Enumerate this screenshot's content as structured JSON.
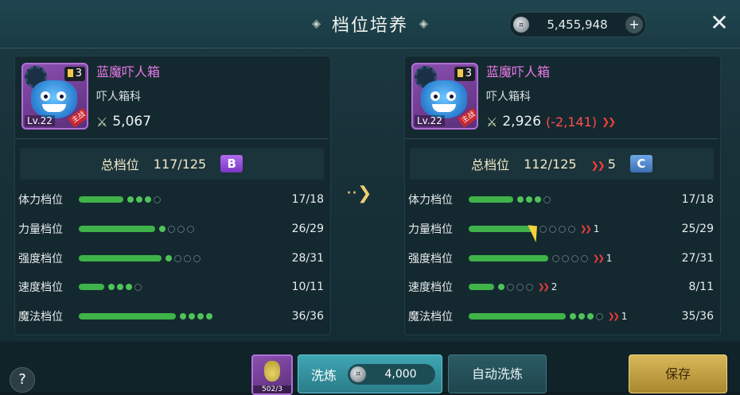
{
  "header": {
    "title": "档位培养",
    "currency": "5,455,948",
    "plus": "+",
    "close": "✕"
  },
  "left": {
    "name": "蓝魔吓人箱",
    "family": "吓人箱科",
    "power": "5,067",
    "level": "Lv.22",
    "grade_num": "3",
    "tag": "主战",
    "total_label": "总档位",
    "total_value": "117/125",
    "grade": "B",
    "rows": [
      {
        "label": "体力档位",
        "value": "17/18",
        "progress": 0.944
      },
      {
        "label": "力量档位",
        "value": "26/29",
        "progress": 0.897
      },
      {
        "label": "强度档位",
        "value": "28/31",
        "progress": 0.903
      },
      {
        "label": "速度档位",
        "value": "10/11",
        "progress": 0.909
      },
      {
        "label": "魔法档位",
        "value": "36/36",
        "progress": 1.0
      }
    ]
  },
  "right": {
    "name": "蓝魔吓人箱",
    "family": "吓人箱科",
    "power": "2,926",
    "power_diff": "(-2,141)",
    "level": "Lv.22",
    "grade_num": "3",
    "tag": "主战",
    "total_label": "总档位",
    "total_value": "112/125",
    "total_drop": "5",
    "grade": "C",
    "rows": [
      {
        "label": "体力档位",
        "value": "17/18",
        "drop": ""
      },
      {
        "label": "力量档位",
        "value": "25/29",
        "drop": "1"
      },
      {
        "label": "强度档位",
        "value": "27/31",
        "drop": "1"
      },
      {
        "label": "速度档位",
        "value": "8/11",
        "drop": "2"
      },
      {
        "label": "魔法档位",
        "value": "35/36",
        "drop": "1"
      }
    ]
  },
  "footer": {
    "help": "?",
    "potion_count": "502/3",
    "wash_label": "洗炼",
    "wash_cost": "4,000",
    "auto_label": "自动洗炼",
    "save_label": "保存"
  },
  "colors": {
    "accent_green": "#3fb24a",
    "decrease_red": "#ff3b3b",
    "name_pink": "#e87ae8"
  }
}
